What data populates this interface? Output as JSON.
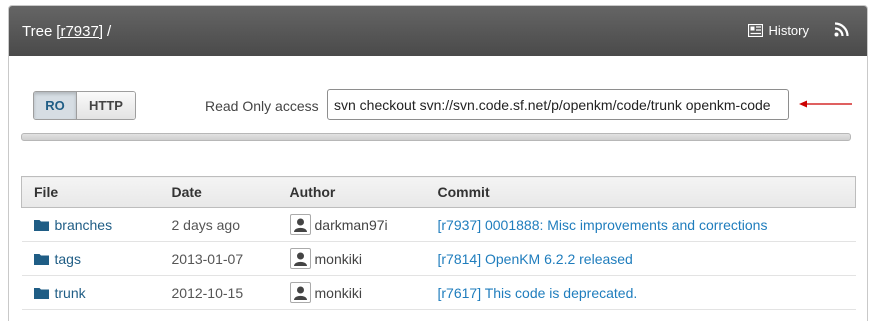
{
  "header": {
    "title_prefix": "Tree",
    "revision": "[r7937]",
    "title_suffix": "/",
    "history_label": "History",
    "history_icon": "history-icon",
    "rss_icon": "rss-icon"
  },
  "checkout": {
    "tabs": [
      {
        "label": "RO",
        "selected": true
      },
      {
        "label": "HTTP",
        "selected": false
      }
    ],
    "access_label": "Read Only access",
    "command": "svn checkout svn://svn.code.sf.net/p/openkm/code/trunk openkm-code"
  },
  "colors": {
    "header_bg": "#555555",
    "link": "#1f5d85",
    "commit_link": "#1f7dbd",
    "arrow": "#cc0000"
  },
  "table": {
    "columns": [
      "File",
      "Date",
      "Author",
      "Commit"
    ],
    "rows": [
      {
        "file": "branches",
        "date": "2 days ago",
        "author": "darkman97i",
        "commit": "[r7937] 0001888: Misc improvements and corrections"
      },
      {
        "file": "tags",
        "date": "2013-01-07",
        "author": "monkiki",
        "commit": "[r7814] OpenKM 6.2.2 released"
      },
      {
        "file": "trunk",
        "date": "2012-10-15",
        "author": "monkiki",
        "commit": "[r7617] This code is deprecated."
      }
    ]
  }
}
